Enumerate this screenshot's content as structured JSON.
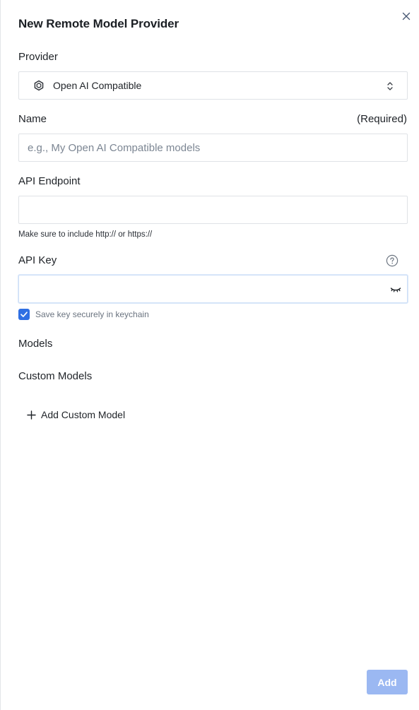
{
  "dialog": {
    "title": "New Remote Model Provider"
  },
  "provider": {
    "label": "Provider",
    "selected": "Open AI Compatible",
    "icon": "openai-hex-icon"
  },
  "name": {
    "label": "Name",
    "required_text": "(Required)",
    "value": "",
    "placeholder": "e.g., My Open AI Compatible models"
  },
  "endpoint": {
    "label": "API Endpoint",
    "value": "",
    "placeholder": "",
    "hint": "Make sure to include http:// or https://"
  },
  "api_key": {
    "label": "API Key",
    "value": "",
    "placeholder": "",
    "save_label": "Save key securely in keychain",
    "save_checked": true
  },
  "models": {
    "label": "Models"
  },
  "custom_models": {
    "label": "Custom Models",
    "add_label": "Add Custom Model"
  },
  "footer": {
    "add_label": "Add"
  },
  "colors": {
    "accent": "#2f6fe3",
    "add_button_disabled": "#9bb8f2",
    "border": "#dfe2e6",
    "placeholder": "#7c8693"
  }
}
